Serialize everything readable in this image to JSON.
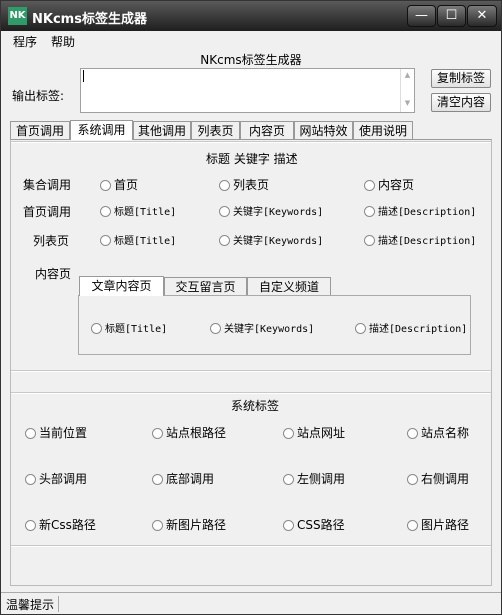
{
  "window": {
    "title": "NKcms标签生成器",
    "icon_text": "NK",
    "minimize": "—",
    "maximize": "☐",
    "close": "✕"
  },
  "menu": [
    "程序",
    "帮助"
  ],
  "header": {
    "title": "NKcms标签生成器"
  },
  "output": {
    "label": "输出标签:",
    "value": ""
  },
  "buttons": {
    "copy": "复制标签",
    "clear": "清空内容"
  },
  "tabs": [
    "首页调用",
    "系统调用",
    "其他调用",
    "列表页",
    "内容页",
    "网站特效",
    "使用说明"
  ],
  "active_tab": "系统调用",
  "section1": {
    "title": "标题 关键字 描述",
    "rows": [
      {
        "label": "集合调用",
        "options": [
          "首页",
          "列表页",
          "内容页"
        ]
      },
      {
        "label": "首页调用",
        "options": [
          "标题[Title]",
          "关键字[Keywords]",
          "描述[Description]"
        ]
      },
      {
        "label": "列表页",
        "options": [
          "标题[Title]",
          "关键字[Keywords]",
          "描述[Description]"
        ]
      }
    ],
    "content_label": "内容页",
    "sub_tabs": [
      "文章内容页",
      "交互留言页",
      "自定义频道"
    ],
    "sub_options": [
      "标题[Title]",
      "关键字[Keywords]",
      "描述[Description]"
    ]
  },
  "section2": {
    "title": "系统标签",
    "rows": [
      [
        "当前位置",
        "站点根路径",
        "站点网址",
        "站点名称"
      ],
      [
        "头部调用",
        "底部调用",
        "左侧调用",
        "右侧调用"
      ],
      [
        "新Css路径",
        "新图片路径",
        "CSS路径",
        "图片路径"
      ]
    ]
  },
  "status": {
    "text": "温馨提示"
  }
}
